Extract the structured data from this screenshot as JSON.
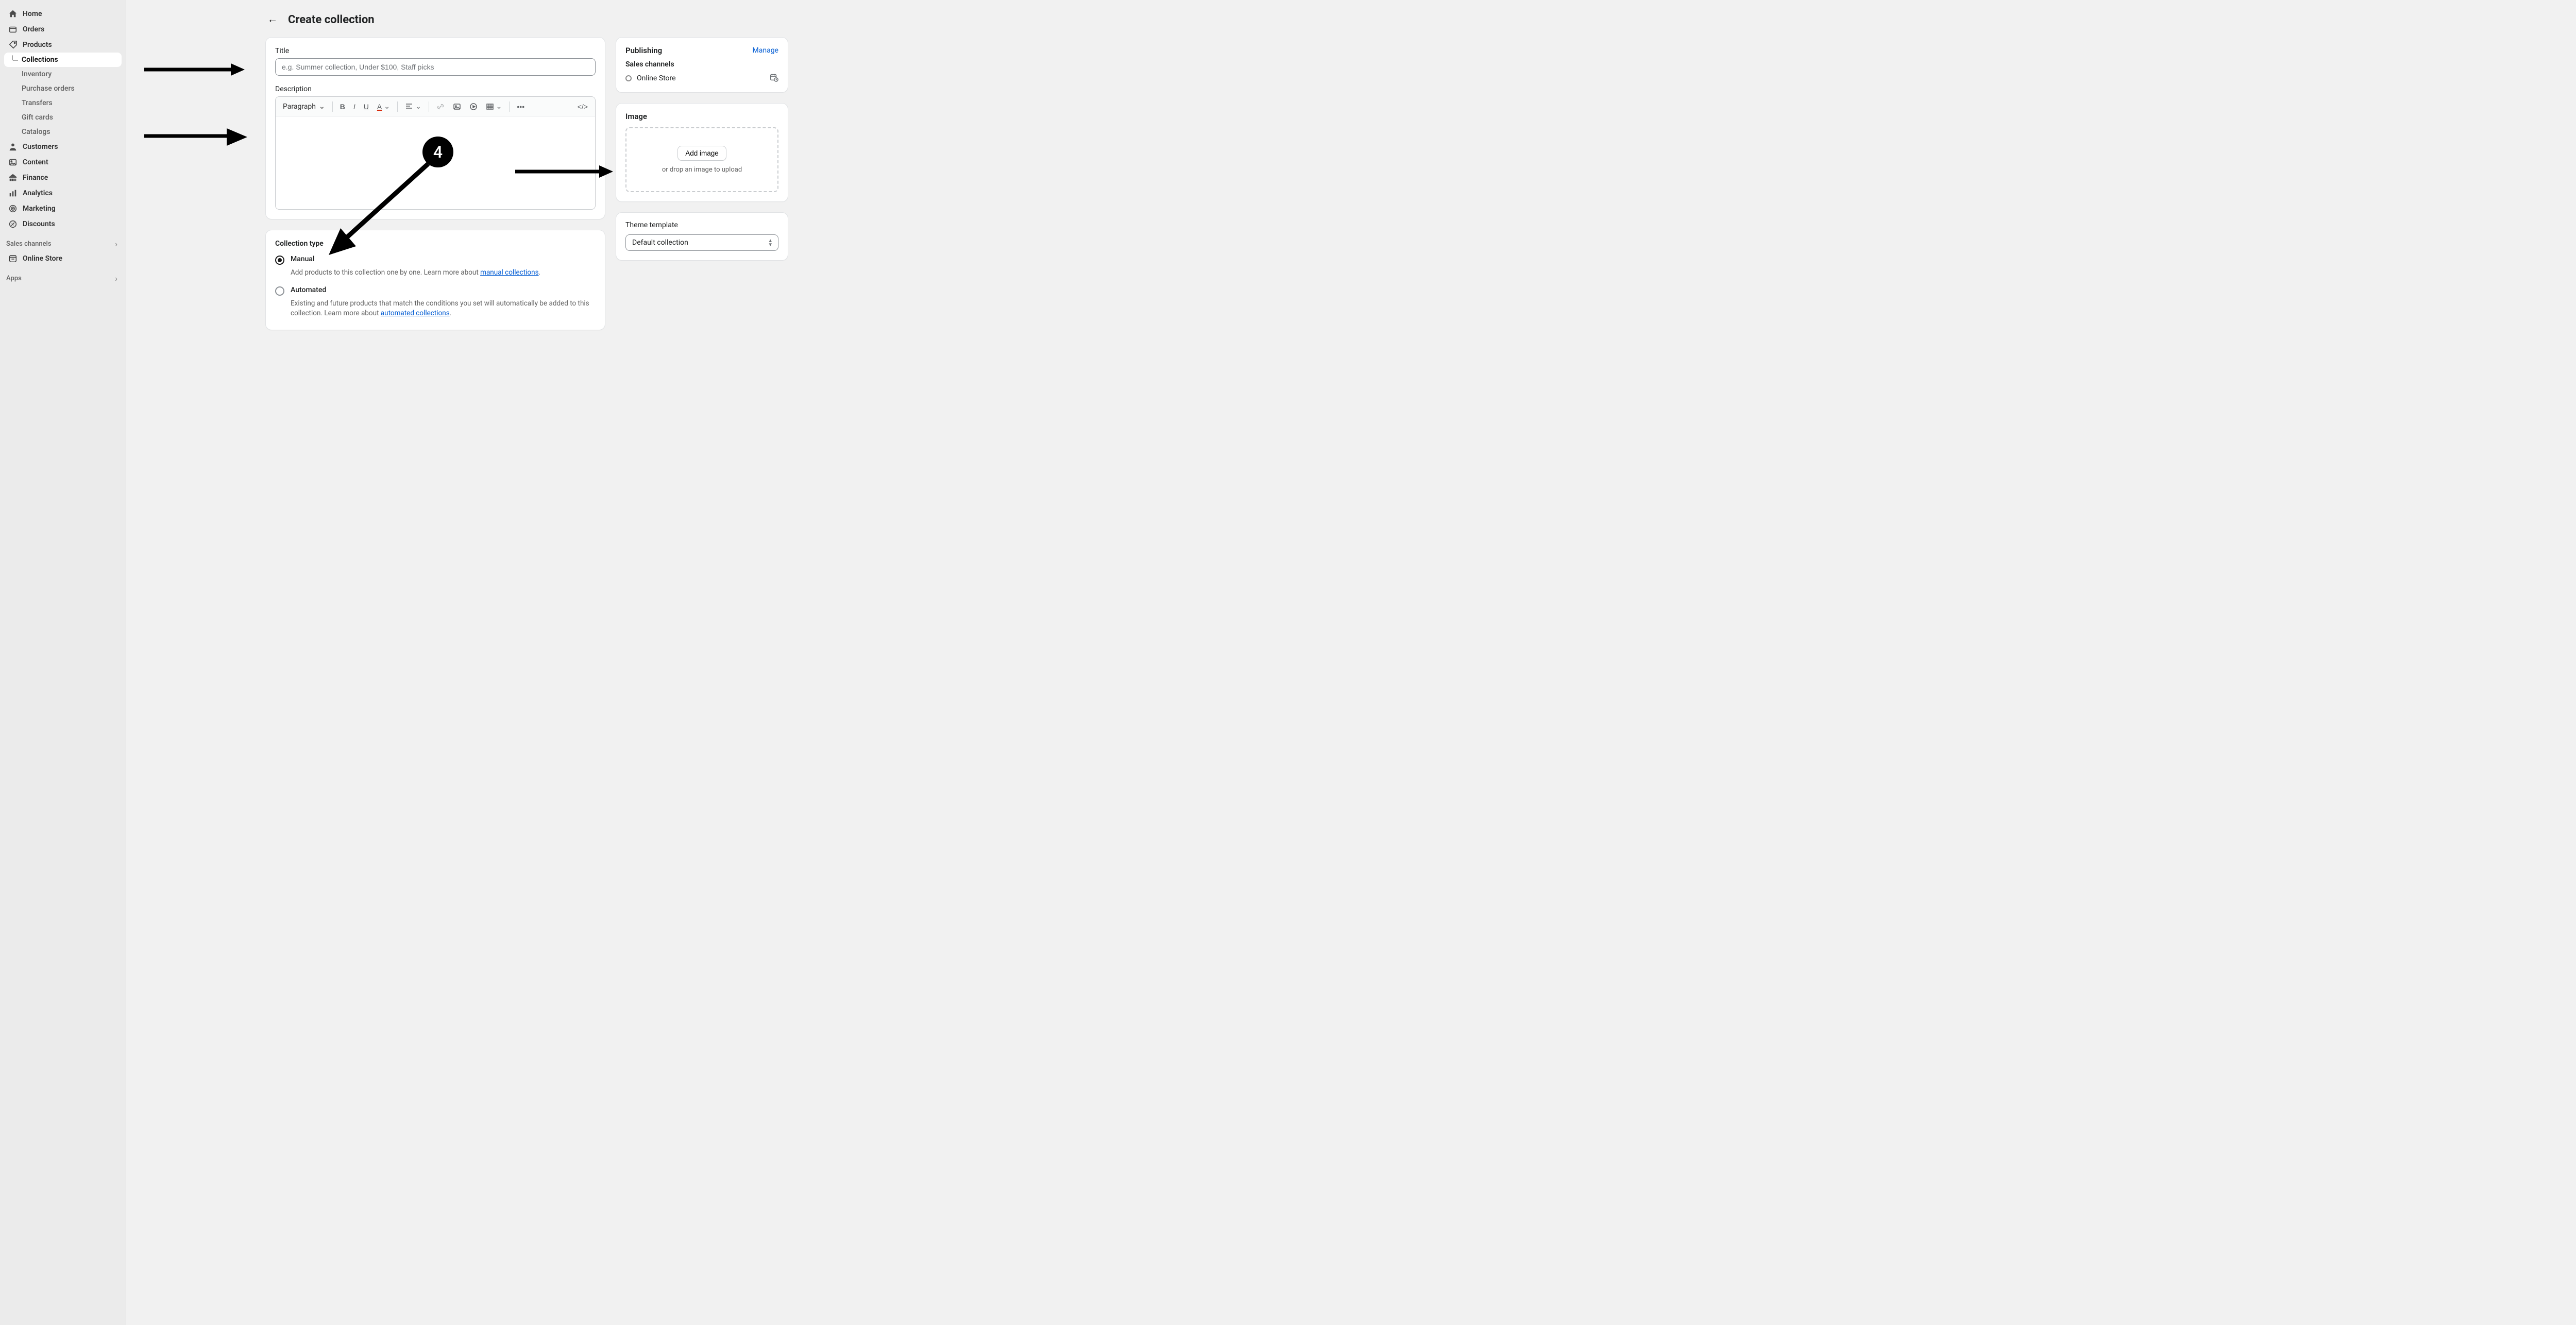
{
  "sidebar": {
    "home": "Home",
    "orders": "Orders",
    "products": "Products",
    "products_children": {
      "collections": "Collections",
      "inventory": "Inventory",
      "purchase_orders": "Purchase orders",
      "transfers": "Transfers",
      "gift_cards": "Gift cards",
      "catalogs": "Catalogs"
    },
    "customers": "Customers",
    "content": "Content",
    "finance": "Finance",
    "analytics": "Analytics",
    "marketing": "Marketing",
    "discounts": "Discounts",
    "sales_channels_label": "Sales channels",
    "online_store": "Online Store",
    "apps_label": "Apps"
  },
  "header": {
    "title": "Create collection"
  },
  "title_card": {
    "label": "Title",
    "placeholder": "e.g. Summer collection, Under $100, Staff picks"
  },
  "description_card": {
    "label": "Description",
    "paragraph_label": "Paragraph"
  },
  "collection_type": {
    "section_title": "Collection type",
    "manual_label": "Manual",
    "manual_help_prefix": "Add products to this collection one by one. Learn more about ",
    "manual_link": "manual collections",
    "automated_label": "Automated",
    "automated_help_prefix": "Existing and future products that match the conditions you set will automatically be added to this collection. Learn more about ",
    "automated_link": "automated collections"
  },
  "publishing": {
    "title": "Publishing",
    "manage": "Manage",
    "sales_channels": "Sales channels",
    "online_store": "Online Store"
  },
  "image_card": {
    "title": "Image",
    "button": "Add image",
    "help": "or drop an image to upload"
  },
  "theme_card": {
    "title": "Theme template",
    "value": "Default collection"
  },
  "annotation": {
    "number": "4"
  }
}
